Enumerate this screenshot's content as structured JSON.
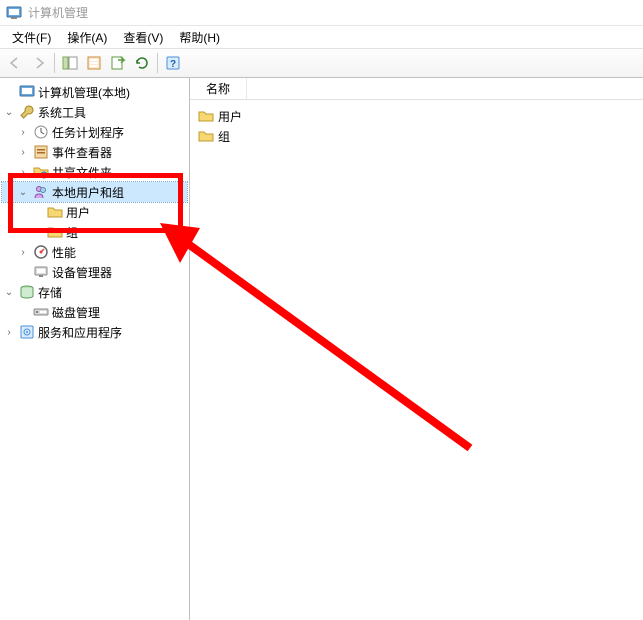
{
  "window": {
    "title": "计算机管理"
  },
  "menu": {
    "file": "文件(F)",
    "action": "操作(A)",
    "view": "查看(V)",
    "help": "帮助(H)"
  },
  "tree": {
    "root": "计算机管理(本地)",
    "system_tools": "系统工具",
    "task_scheduler": "任务计划程序",
    "event_viewer": "事件查看器",
    "shared_folders": "共享文件夹",
    "local_users_groups": "本地用户和组",
    "users": "用户",
    "groups": "组",
    "performance": "性能",
    "device_manager": "设备管理器",
    "storage": "存储",
    "disk_management": "磁盘管理",
    "services_apps": "服务和应用程序"
  },
  "list": {
    "header_name": "名称",
    "row_users": "用户",
    "row_groups": "组"
  }
}
